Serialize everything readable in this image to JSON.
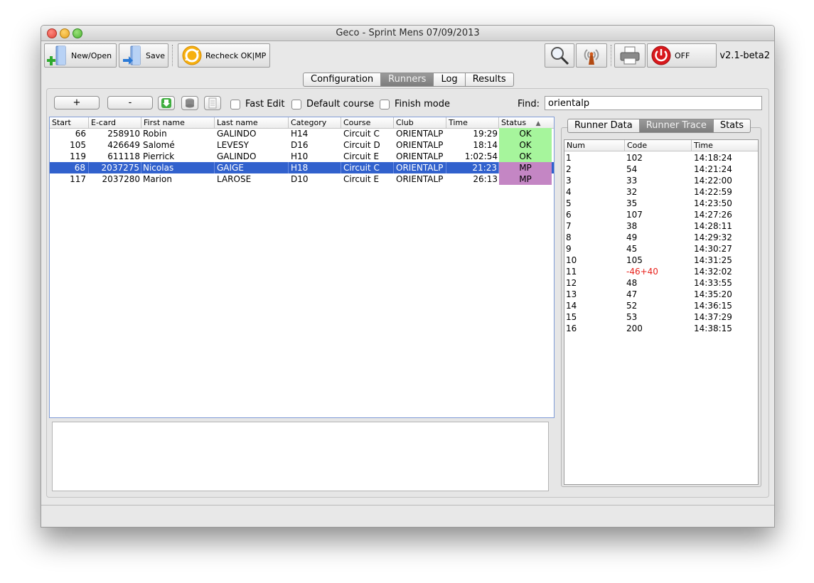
{
  "window": {
    "title": "Geco - Sprint Mens 07/09/2013"
  },
  "toolbar": {
    "new_open_label": "New/Open",
    "save_label": "Save",
    "recheck_label": "Recheck OK|MP",
    "off_label": "OFF",
    "version": "v2.1-beta2"
  },
  "tabs": [
    {
      "label": "Configuration"
    },
    {
      "label": "Runners"
    },
    {
      "label": "Log"
    },
    {
      "label": "Results"
    }
  ],
  "runners_panel": {
    "add_label": "+",
    "remove_label": "-",
    "fast_edit_label": "Fast Edit",
    "default_course_label": "Default course",
    "finish_mode_label": "Finish mode",
    "find_label": "Find:",
    "find_value": "orientalp",
    "columns": [
      "Start",
      "E-card",
      "First name",
      "Last name",
      "Category",
      "Course",
      "Club",
      "Time",
      "Status"
    ],
    "sort_indicator": "▲",
    "rows": [
      {
        "start": "66",
        "ecard": "258910",
        "first": "Robin",
        "last": "GALINDO",
        "category": "H14",
        "course": "Circuit C",
        "club": "ORIENTALP",
        "time": "19:29",
        "status": "OK"
      },
      {
        "start": "105",
        "ecard": "426649",
        "first": "Salomé",
        "last": "LEVESY",
        "category": "D16",
        "course": "Circuit D",
        "club": "ORIENTALP",
        "time": "18:14",
        "status": "OK"
      },
      {
        "start": "119",
        "ecard": "611118",
        "first": "Pierrick",
        "last": "GALINDO",
        "category": "H10",
        "course": "Circuit E",
        "club": "ORIENTALP",
        "time": "1:02:54",
        "status": "OK"
      },
      {
        "start": "68",
        "ecard": "2037275",
        "first": "Nicolas",
        "last": "GAIGE",
        "category": "H18",
        "course": "Circuit C",
        "club": "ORIENTALP",
        "time": "21:23",
        "status": "MP"
      },
      {
        "start": "117",
        "ecard": "2037280",
        "first": "Marion",
        "last": "LAROSE",
        "category": "D10",
        "course": "Circuit E",
        "club": "ORIENTALP",
        "time": "26:13",
        "status": "MP"
      }
    ],
    "selected_row": 3,
    "status_colors": {
      "ok": "#a6f59c",
      "mp": "#c486c4",
      "selection": "#3161cd"
    }
  },
  "right_panel": {
    "tabs": [
      {
        "label": "Runner Data"
      },
      {
        "label": "Runner Trace"
      },
      {
        "label": "Stats"
      }
    ],
    "trace_columns": [
      "Num",
      "Code",
      "Time"
    ],
    "trace": [
      {
        "num": "1",
        "code": "102",
        "time": "14:18:24"
      },
      {
        "num": "2",
        "code": "54",
        "time": "14:21:24"
      },
      {
        "num": "3",
        "code": "33",
        "time": "14:22:00"
      },
      {
        "num": "4",
        "code": "32",
        "time": "14:22:59"
      },
      {
        "num": "5",
        "code": "35",
        "time": "14:23:50"
      },
      {
        "num": "6",
        "code": "107",
        "time": "14:27:26"
      },
      {
        "num": "7",
        "code": "38",
        "time": "14:28:11"
      },
      {
        "num": "8",
        "code": "49",
        "time": "14:29:32"
      },
      {
        "num": "9",
        "code": "45",
        "time": "14:30:27"
      },
      {
        "num": "10",
        "code": "105",
        "time": "14:31:25"
      },
      {
        "num": "11",
        "code": "-46+40",
        "time": "14:32:02",
        "error": true
      },
      {
        "num": "12",
        "code": "48",
        "time": "14:33:55"
      },
      {
        "num": "13",
        "code": "47",
        "time": "14:35:20"
      },
      {
        "num": "14",
        "code": "52",
        "time": "14:36:15"
      },
      {
        "num": "15",
        "code": "53",
        "time": "14:37:29"
      },
      {
        "num": "16",
        "code": "200",
        "time": "14:38:15"
      }
    ],
    "error_color": "#e8221c"
  },
  "icons": [
    "new-open-icon",
    "save-icon",
    "recheck-icon",
    "search-icon",
    "antenna-icon",
    "printer-icon",
    "power-icon",
    "download-icon",
    "database-icon",
    "document-icon",
    "sort-ascending-icon"
  ]
}
